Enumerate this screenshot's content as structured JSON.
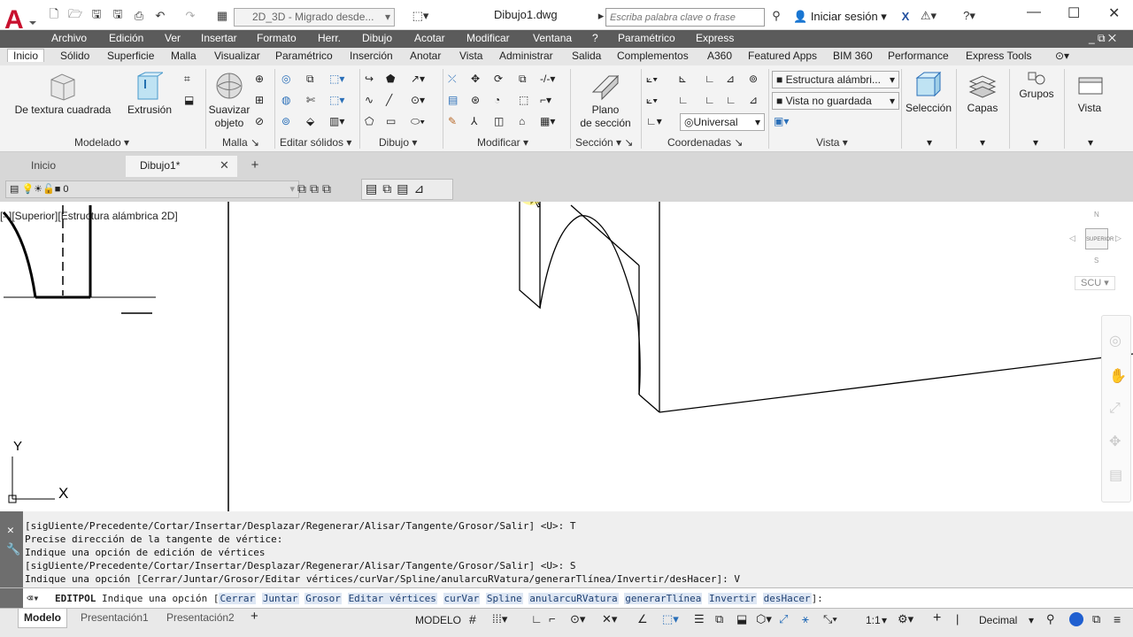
{
  "title_bar": {
    "workspace": "2D_3D - Migrado desde...",
    "file_title": "Dibujo1.dwg",
    "search_placeholder": "Escriba palabra clave o frase",
    "signin": "Iniciar sesión"
  },
  "menu": [
    "Archivo",
    "Edición",
    "Ver",
    "Insertar",
    "Formato",
    "Herr.",
    "Dibujo",
    "Acotar",
    "Modificar",
    "Ventana",
    "?",
    "Paramétrico",
    "Express"
  ],
  "ribbon_tabs": [
    "Inicio",
    "Sólido",
    "Superficie",
    "Malla",
    "Visualizar",
    "Paramétrico",
    "Inserción",
    "Anotar",
    "Vista",
    "Administrar",
    "Salida",
    "Complementos",
    "A360",
    "Featured Apps",
    "BIM 360",
    "Performance",
    "Express Tools"
  ],
  "ribbon": {
    "box_label": "De textura cuadrada",
    "extrude_label": "Extrusión",
    "smooth_label_1": "Suavizar",
    "smooth_label_2": "objeto",
    "section_label_1": "Plano",
    "section_label_2": "de sección",
    "visual_style": "Estructura alámbri...",
    "view_saved": "Vista no guardada",
    "ucs": "Universal",
    "selection_label": "Selección",
    "layers_label": "Capas",
    "groups_label": "Grupos",
    "view_label": "Vista",
    "panels": [
      "Modelado",
      "Malla",
      "Editar sólidos",
      "Dibujo",
      "Modificar",
      "Sección",
      "Coordenadas",
      "Vista"
    ]
  },
  "doc_tabs": [
    "Inicio",
    "Dibujo1*"
  ],
  "layer": {
    "name": "0"
  },
  "viewport": {
    "label": "[–][Superior][Estructura alámbrica 2D]",
    "viewcube_top": "SUPERIOR",
    "ucs_menu": "SCU",
    "axis_y": "Y",
    "axis_x": "X"
  },
  "command_history": [
    "[sigUiente/Precedente/Cortar/Insertar/Desplazar/Regenerar/Alisar/Tangente/Grosor/Salir] <U>: T",
    "Precise dirección de la tangente de vértice:",
    "Indique una opción de edición de vértices",
    "[sigUiente/Precedente/Cortar/Insertar/Desplazar/Regenerar/Alisar/Tangente/Grosor/Salir] <U>: S",
    "Indique una opción [Cerrar/Juntar/Grosor/Editar vértices/curVar/Spline/anularcuRVatura/generarTlínea/Invertir/desHacer]: V"
  ],
  "command_line": {
    "command": "EDITPOL",
    "prompt": "Indique una opción [",
    "options": [
      "Cerrar",
      "Juntar",
      "Grosor",
      "Editar vértices",
      "curVar",
      "Spline",
      "anularcuRVatura",
      "generarTlínea",
      "Invertir",
      "desHacer"
    ],
    "suffix": "]:"
  },
  "status": {
    "layout_tabs": [
      "Modelo",
      "Presentación1",
      "Presentación2"
    ],
    "model": "MODELO",
    "scale": "1:1",
    "units": "Decimal"
  }
}
